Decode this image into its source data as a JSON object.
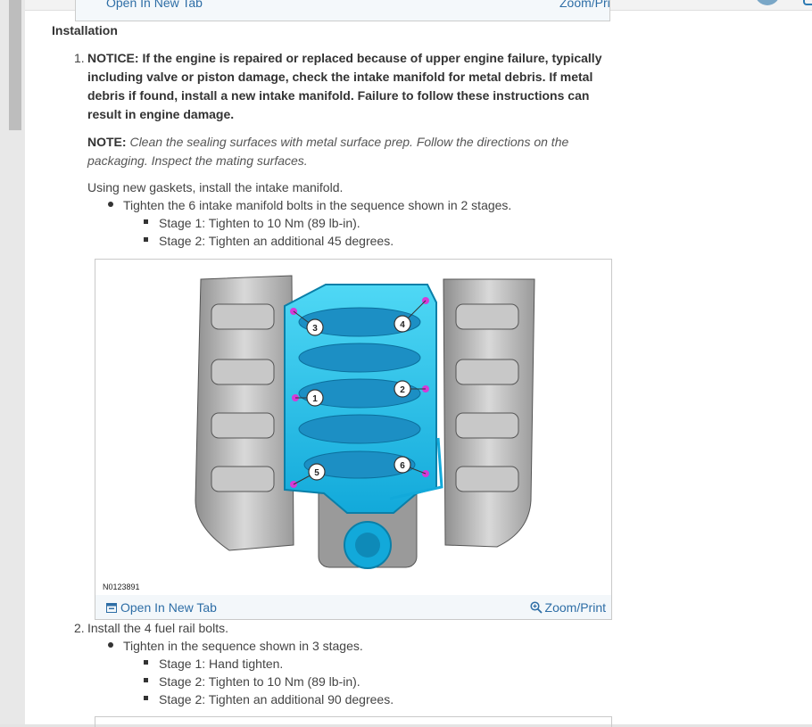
{
  "previous_figure": {
    "open_label": "Open In New Tab",
    "zoom_label": "Zoom/Print"
  },
  "section_title": "Installation",
  "steps": [
    {
      "number": "1.",
      "notice": "NOTICE: If the engine is repaired or replaced because of upper engine failure, typically including valve or piston damage, check the intake manifold for metal debris. If metal debris if found, install a new intake manifold. Failure to follow these instructions can result in engine damage.",
      "note_label": "NOTE:",
      "note_text": "Clean the sealing surfaces with metal surface prep. Follow the directions on the packaging. Inspect the mating surfaces.",
      "instruction": "Using new gaskets, install the intake manifold.",
      "bullet": "Tighten the 6 intake manifold bolts in the sequence shown in 2 stages.",
      "stages": [
        "Stage 1: Tighten to 10 Nm (89 lb-in).",
        "Stage 2: Tighten an additional 45 degrees."
      ]
    },
    {
      "number": "2.",
      "instruction": "Install the 4 fuel rail bolts.",
      "bullet": "Tighten in the sequence shown in 3 stages.",
      "stages": [
        "Stage 1: Hand tighten.",
        "Stage 2: Tighten to 10 Nm (89 lb-in).",
        "Stage 2: Tighten an additional 90 degrees."
      ]
    }
  ],
  "figure": {
    "id": "N0123891",
    "callouts": [
      "1",
      "2",
      "3",
      "4",
      "5",
      "6"
    ],
    "open_label": "Open In New Tab",
    "zoom_label": "Zoom/Print",
    "manifold_color": "#1fc3ea",
    "bolt_marker_color": "#d63ad6"
  }
}
